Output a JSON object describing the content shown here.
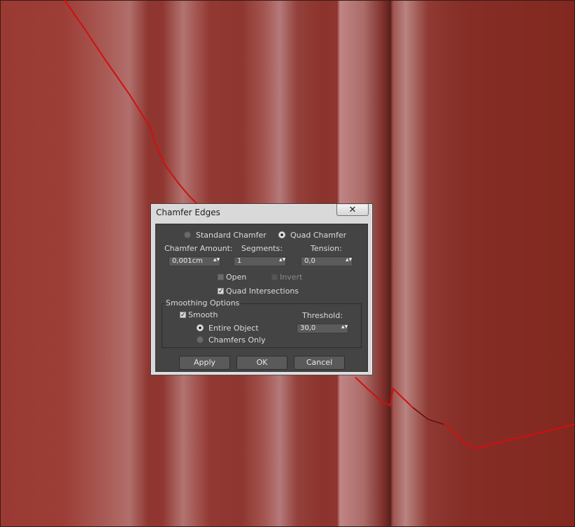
{
  "dialog": {
    "title": "Chamfer Edges",
    "close_glyph": "✕"
  },
  "mode": {
    "standard_label": "Standard Chamfer",
    "quad_label": "Quad Chamfer",
    "selected": "Quad Chamfer"
  },
  "params": {
    "amount_label": "Chamfer Amount:",
    "amount_value": "0,001cm",
    "segments_label": "Segments:",
    "segments_value": "1",
    "tension_label": "Tension:",
    "tension_value": "0,0"
  },
  "options": {
    "open_label": "Open",
    "open_checked": false,
    "invert_label": "Invert",
    "invert_enabled": false,
    "quad_intersections_label": "Quad Intersections",
    "quad_intersections_checked": true
  },
  "smoothing": {
    "group_label": "Smoothing Options",
    "smooth_label": "Smooth",
    "smooth_checked": true,
    "threshold_label": "Threshold:",
    "threshold_value": "30,0",
    "entire_object_label": "Entire Object",
    "chamfers_only_label": "Chamfers Only",
    "selected": "Entire Object"
  },
  "buttons": {
    "apply": "Apply",
    "ok": "OK",
    "cancel": "Cancel"
  },
  "spinner_glyph": "▲▼",
  "check_glyph": "✓",
  "colors": {
    "viewport_red": "#8f3630",
    "edge_line": "#d01010",
    "panel_bg": "#444444",
    "dialog_chrome": "#d9d9d9"
  }
}
